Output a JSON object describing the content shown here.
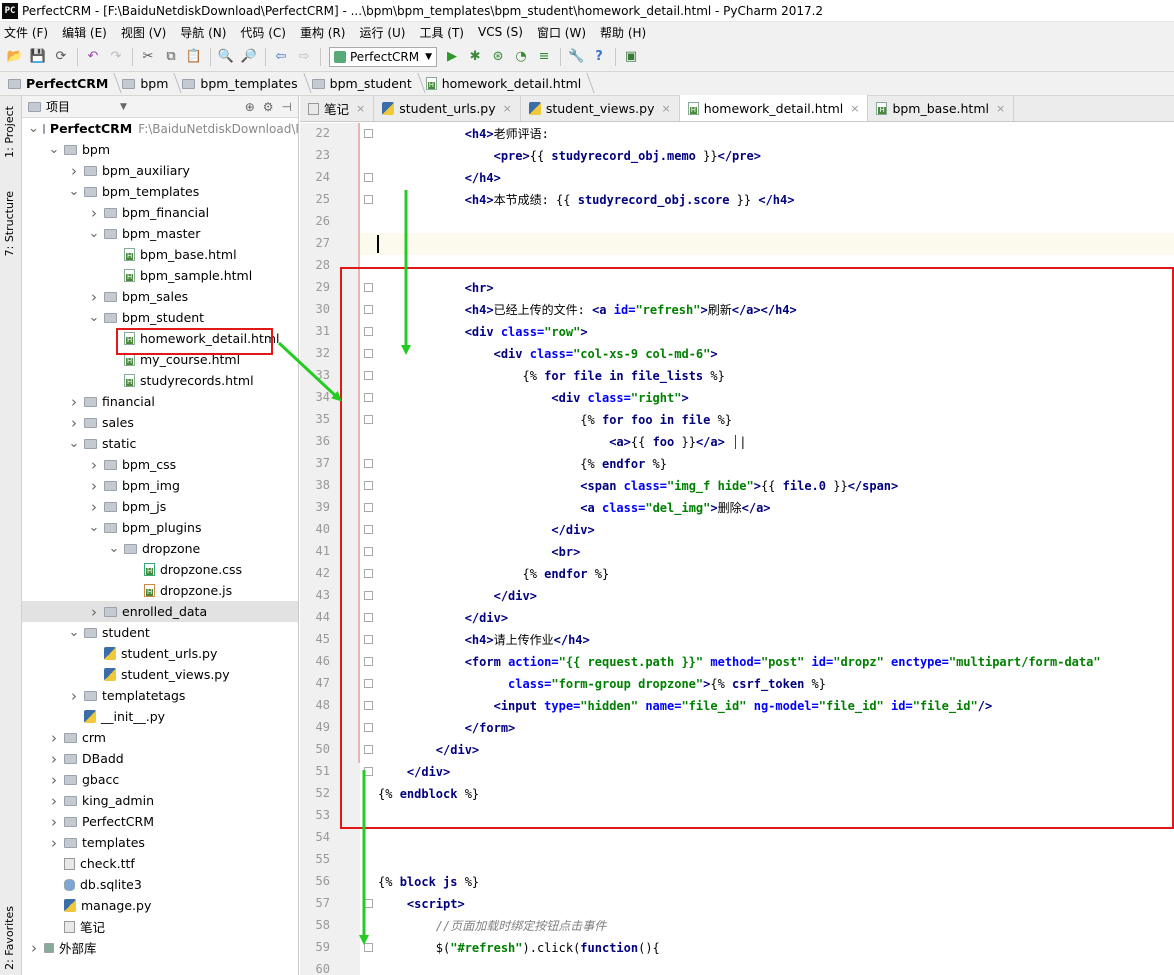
{
  "window": {
    "title": "PerfectCRM - [F:\\BaiduNetdiskDownload\\PerfectCRM] - ...\\bpm\\bpm_templates\\bpm_student\\homework_detail.html - PyCharm 2017.2",
    "logo": "PC"
  },
  "menu": [
    "文件 (F)",
    "编辑 (E)",
    "视图 (V)",
    "导航 (N)",
    "代码 (C)",
    "重构 (R)",
    "运行 (U)",
    "工具 (T)",
    "VCS (S)",
    "窗口 (W)",
    "帮助 (H)"
  ],
  "toolbar": {
    "run_config": "PerfectCRM",
    "icons": [
      "open-icon",
      "save-icon",
      "sync-icon",
      "undo-icon",
      "redo-icon",
      "cut-icon",
      "copy-icon",
      "paste-icon",
      "find-icon",
      "replace-icon",
      "back-icon",
      "forward-icon",
      "run-icon",
      "debug-icon",
      "coverage-icon",
      "profile-icon",
      "concurrency-icon",
      "settings-icon",
      "help-icon",
      "python-console-icon"
    ]
  },
  "breadcrumbs": [
    "PerfectCRM",
    "bpm",
    "bpm_templates",
    "bpm_student",
    "homework_detail.html"
  ],
  "side_tabs": {
    "project": "1: Project",
    "structure": "7: Structure",
    "favorites": "2: Favorites"
  },
  "project_panel": {
    "title": "项目",
    "tree": [
      {
        "label": "PerfectCRM",
        "path": "F:\\BaiduNetdiskDownload\\PerfectCRM",
        "level": 0,
        "type": "folder",
        "exp": "open",
        "bold": true
      },
      {
        "label": "bpm",
        "level": 1,
        "type": "folder",
        "exp": "open"
      },
      {
        "label": "bpm_auxiliary",
        "level": 2,
        "type": "folder",
        "exp": "closed"
      },
      {
        "label": "bpm_templates",
        "level": 2,
        "type": "folder",
        "exp": "open"
      },
      {
        "label": "bpm_financial",
        "level": 3,
        "type": "folder",
        "exp": "closed"
      },
      {
        "label": "bpm_master",
        "level": 3,
        "type": "folder",
        "exp": "open"
      },
      {
        "label": "bpm_base.html",
        "level": 4,
        "type": "html"
      },
      {
        "label": "bpm_sample.html",
        "level": 4,
        "type": "html"
      },
      {
        "label": "bpm_sales",
        "level": 3,
        "type": "folder",
        "exp": "closed"
      },
      {
        "label": "bpm_student",
        "level": 3,
        "type": "folder",
        "exp": "open"
      },
      {
        "label": "homework_detail.html",
        "level": 4,
        "type": "html"
      },
      {
        "label": "my_course.html",
        "level": 4,
        "type": "html"
      },
      {
        "label": "studyrecords.html",
        "level": 4,
        "type": "html"
      },
      {
        "label": "financial",
        "level": 2,
        "type": "folder",
        "exp": "closed"
      },
      {
        "label": "sales",
        "level": 2,
        "type": "folder",
        "exp": "closed"
      },
      {
        "label": "static",
        "level": 2,
        "type": "folder",
        "exp": "open"
      },
      {
        "label": "bpm_css",
        "level": 3,
        "type": "folder",
        "exp": "closed"
      },
      {
        "label": "bpm_img",
        "level": 3,
        "type": "folder",
        "exp": "closed"
      },
      {
        "label": "bpm_js",
        "level": 3,
        "type": "folder",
        "exp": "closed"
      },
      {
        "label": "bpm_plugins",
        "level": 3,
        "type": "folder",
        "exp": "open"
      },
      {
        "label": "dropzone",
        "level": 4,
        "type": "folder",
        "exp": "open"
      },
      {
        "label": "dropzone.css",
        "level": 5,
        "type": "css"
      },
      {
        "label": "dropzone.js",
        "level": 5,
        "type": "js"
      },
      {
        "label": "enrolled_data",
        "level": 3,
        "type": "folder",
        "exp": "closed",
        "selected": true
      },
      {
        "label": "student",
        "level": 2,
        "type": "folder",
        "exp": "open"
      },
      {
        "label": "student_urls.py",
        "level": 3,
        "type": "py"
      },
      {
        "label": "student_views.py",
        "level": 3,
        "type": "py"
      },
      {
        "label": "templatetags",
        "level": 2,
        "type": "folder",
        "exp": "closed"
      },
      {
        "label": "__init__.py",
        "level": 2,
        "type": "py"
      },
      {
        "label": "crm",
        "level": 1,
        "type": "folder",
        "exp": "closed"
      },
      {
        "label": "DBadd",
        "level": 1,
        "type": "folder",
        "exp": "closed"
      },
      {
        "label": "gbacc",
        "level": 1,
        "type": "folder",
        "exp": "closed"
      },
      {
        "label": "king_admin",
        "level": 1,
        "type": "folder",
        "exp": "closed"
      },
      {
        "label": "PerfectCRM",
        "level": 1,
        "type": "folder",
        "exp": "closed"
      },
      {
        "label": "templates",
        "level": 1,
        "type": "folder",
        "exp": "closed"
      },
      {
        "label": "check.ttf",
        "level": 1,
        "type": "txt"
      },
      {
        "label": "db.sqlite3",
        "level": 1,
        "type": "db"
      },
      {
        "label": "manage.py",
        "level": 1,
        "type": "py"
      },
      {
        "label": "笔记",
        "level": 1,
        "type": "txt"
      },
      {
        "label": "外部库",
        "level": 0,
        "type": "lib",
        "exp": "closed"
      }
    ]
  },
  "editor_tabs": [
    {
      "label": "笔记",
      "icon": "note"
    },
    {
      "label": "student_urls.py",
      "icon": "py"
    },
    {
      "label": "student_views.py",
      "icon": "py"
    },
    {
      "label": "homework_detail.html",
      "icon": "html",
      "active": true
    },
    {
      "label": "bpm_base.html",
      "icon": "html"
    }
  ],
  "code": {
    "first_line": 22,
    "lines": [
      [
        [
          "t",
          "            "
        ],
        [
          "tag",
          "<h4>"
        ],
        [
          "t",
          "老师评语:"
        ]
      ],
      [
        [
          "t",
          "                "
        ],
        [
          "tag",
          "<pre>"
        ],
        [
          "t",
          "{{ "
        ],
        [
          "tpl",
          "studyrecord_obj.memo"
        ],
        [
          "t",
          " }}"
        ],
        [
          "tag",
          "</pre>"
        ]
      ],
      [
        [
          "t",
          "            "
        ],
        [
          "tag",
          "</h4>"
        ]
      ],
      [
        [
          "t",
          "            "
        ],
        [
          "tag",
          "<h4>"
        ],
        [
          "t",
          "本节成绩: {{ "
        ],
        [
          "tpl",
          "studyrecord_obj.score"
        ],
        [
          "t",
          " }} "
        ],
        [
          "tag",
          "</h4>"
        ]
      ],
      [
        [
          "t",
          ""
        ]
      ],
      [
        [
          "t",
          ""
        ]
      ],
      [
        [
          "t",
          ""
        ]
      ],
      [
        [
          "t",
          "            "
        ],
        [
          "tag",
          "<hr>"
        ]
      ],
      [
        [
          "t",
          "            "
        ],
        [
          "tag",
          "<h4>"
        ],
        [
          "t",
          "已经上传的文件: "
        ],
        [
          "tag",
          "<a "
        ],
        [
          "attr",
          "id="
        ],
        [
          "str",
          "\"refresh\""
        ],
        [
          "tag",
          ">"
        ],
        [
          "t",
          "刷新"
        ],
        [
          "tag",
          "</a></h4>"
        ]
      ],
      [
        [
          "t",
          "            "
        ],
        [
          "tag",
          "<div "
        ],
        [
          "attr",
          "class="
        ],
        [
          "str",
          "\"row\""
        ],
        [
          "tag",
          ">"
        ]
      ],
      [
        [
          "t",
          "                "
        ],
        [
          "tag",
          "<div "
        ],
        [
          "attr",
          "class="
        ],
        [
          "str",
          "\"col-xs-9 col-md-6\""
        ],
        [
          "tag",
          ">"
        ]
      ],
      [
        [
          "t",
          "                    {% "
        ],
        [
          "tpl",
          "for file in file_lists"
        ],
        [
          "t",
          " %}"
        ]
      ],
      [
        [
          "t",
          "                        "
        ],
        [
          "tag",
          "<div "
        ],
        [
          "attr",
          "class="
        ],
        [
          "str",
          "\"right\""
        ],
        [
          "tag",
          ">"
        ]
      ],
      [
        [
          "t",
          "                            {% "
        ],
        [
          "tpl",
          "for foo in file"
        ],
        [
          "t",
          " %}"
        ]
      ],
      [
        [
          "t",
          "                                "
        ],
        [
          "tag",
          "<a>"
        ],
        [
          "t",
          "{{ "
        ],
        [
          "tpl",
          "foo"
        ],
        [
          "t",
          " }}"
        ],
        [
          "tag",
          "</a>"
        ],
        [
          "t",
          "  |"
        ]
      ],
      [
        [
          "t",
          "                            {% "
        ],
        [
          "tpl",
          "endfor"
        ],
        [
          "t",
          " %}"
        ]
      ],
      [
        [
          "t",
          "                            "
        ],
        [
          "tag",
          "<span "
        ],
        [
          "attr",
          "class="
        ],
        [
          "str",
          "\"img_f hide\""
        ],
        [
          "tag",
          ">"
        ],
        [
          "t",
          "{{ "
        ],
        [
          "tpl",
          "file.0"
        ],
        [
          "t",
          " }}"
        ],
        [
          "tag",
          "</span>"
        ]
      ],
      [
        [
          "t",
          "                            "
        ],
        [
          "tag",
          "<a "
        ],
        [
          "attr",
          "class="
        ],
        [
          "str",
          "\"del_img\""
        ],
        [
          "tag",
          ">"
        ],
        [
          "t",
          "删除"
        ],
        [
          "tag",
          "</a>"
        ]
      ],
      [
        [
          "t",
          "                        "
        ],
        [
          "tag",
          "</div>"
        ]
      ],
      [
        [
          "t",
          "                        "
        ],
        [
          "tag",
          "<br>"
        ]
      ],
      [
        [
          "t",
          "                    {% "
        ],
        [
          "tpl",
          "endfor"
        ],
        [
          "t",
          " %}"
        ]
      ],
      [
        [
          "t",
          "                "
        ],
        [
          "tag",
          "</div>"
        ]
      ],
      [
        [
          "t",
          "            "
        ],
        [
          "tag",
          "</div>"
        ]
      ],
      [
        [
          "t",
          "            "
        ],
        [
          "tag",
          "<h4>"
        ],
        [
          "t",
          "请上传作业"
        ],
        [
          "tag",
          "</h4>"
        ]
      ],
      [
        [
          "t",
          "            "
        ],
        [
          "tag",
          "<form "
        ],
        [
          "attr",
          "action="
        ],
        [
          "str",
          "\"{{ request.path }}\""
        ],
        [
          "t",
          " "
        ],
        [
          "attr",
          "method="
        ],
        [
          "str",
          "\"post\""
        ],
        [
          "t",
          " "
        ],
        [
          "attr",
          "id="
        ],
        [
          "str",
          "\"dropz\""
        ],
        [
          "t",
          " "
        ],
        [
          "attr",
          "enctype="
        ],
        [
          "str",
          "\"multipart/form-data\""
        ]
      ],
      [
        [
          "t",
          "                  "
        ],
        [
          "attr",
          "class="
        ],
        [
          "str",
          "\"form-group dropzone\""
        ],
        [
          "tag",
          ">"
        ],
        [
          "t",
          "{% "
        ],
        [
          "tpl",
          "csrf_token"
        ],
        [
          "t",
          " %}"
        ]
      ],
      [
        [
          "t",
          "                "
        ],
        [
          "tag",
          "<input "
        ],
        [
          "attr",
          "type="
        ],
        [
          "str",
          "\"hidden\""
        ],
        [
          "t",
          " "
        ],
        [
          "attr",
          "name="
        ],
        [
          "str",
          "\"file_id\""
        ],
        [
          "t",
          " "
        ],
        [
          "attr",
          "ng-model="
        ],
        [
          "str",
          "\"file_id\""
        ],
        [
          "t",
          " "
        ],
        [
          "attr",
          "id="
        ],
        [
          "str",
          "\"file_id\""
        ],
        [
          "tag",
          "/>"
        ]
      ],
      [
        [
          "t",
          "            "
        ],
        [
          "tag",
          "</form>"
        ]
      ],
      [
        [
          "t",
          "        "
        ],
        [
          "tag",
          "</div>"
        ]
      ],
      [
        [
          "t",
          "    "
        ],
        [
          "tag",
          "</div>"
        ]
      ],
      [
        [
          "t",
          "{% "
        ],
        [
          "tpl",
          "endblock"
        ],
        [
          "t",
          " %}"
        ]
      ],
      [
        [
          "t",
          ""
        ]
      ],
      [
        [
          "t",
          ""
        ]
      ],
      [
        [
          "t",
          ""
        ]
      ],
      [
        [
          "t",
          "{% "
        ],
        [
          "tpl",
          "block js"
        ],
        [
          "t",
          " %}"
        ]
      ],
      [
        [
          "t",
          "    "
        ],
        [
          "tag",
          "<script>"
        ]
      ],
      [
        [
          "t",
          "        "
        ],
        [
          "cmt",
          "//页面加载时绑定按钮点击事件"
        ]
      ],
      [
        [
          "t",
          "        $("
        ],
        [
          "str",
          "\"#refresh\""
        ],
        [
          "t",
          ").click("
        ],
        [
          "tag",
          "function"
        ],
        [
          "t",
          "(){"
        ]
      ],
      [
        [
          "t",
          ""
        ]
      ]
    ]
  },
  "colors": {
    "highlight_red": "#e01818",
    "arrow_green": "#22cc22"
  }
}
